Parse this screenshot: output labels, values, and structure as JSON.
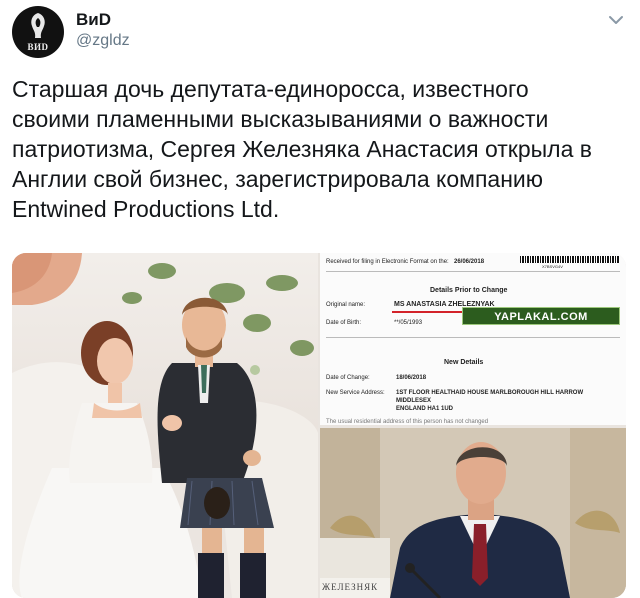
{
  "author": {
    "name": "ВиD",
    "handle": "@zgldz",
    "avatar_text": "ВИD",
    "avatar_icon": "letter-mark-icon"
  },
  "menu_icon": "chevron-down-icon",
  "tweet": {
    "lines": [
      "Старшая дочь депутата-единоросса, известного",
      "своими пламенными высказываниями о важности",
      "патриотизма, Сергея Железняка Анастасия открыла в",
      "Англии свой бизнес, зарегистрировала компанию",
      "Entwined Productions Ltd."
    ]
  },
  "document": {
    "received": "Received for filing in Electronic Format on the:",
    "received_date": "26/06/2018",
    "barcode_text": "X7BSVG4V",
    "section_prior": "Details Prior to Change",
    "original_name_label": "Original name:",
    "original_name_value": "MS ANASTASIA ZHELEZNYAK",
    "dob_label": "Date of Birth:",
    "dob_value": "**/05/1993",
    "section_new": "New Details",
    "change_date_label": "Date of Change:",
    "change_date_value": "18/06/2018",
    "address_label": "New Service Address:",
    "address_line1": "1ST FLOOR HEALTHAID HOUSE MARLBOROUGH HILL HARROW",
    "address_line2": "MIDDLESEX",
    "address_line3": "ENGLAND HA1 1UD",
    "cutoff_line": "The usual residential address of this person has not changed"
  },
  "photo2": {
    "nameplate": "ЖЕЛЕЗНЯК"
  },
  "watermark": {
    "text": "YAPLAKAL.COM"
  },
  "colors": {
    "text": "#14171a",
    "secondary": "#657786",
    "watermark_bg": "#2c5c1e",
    "underline_red": "#d3232a"
  }
}
